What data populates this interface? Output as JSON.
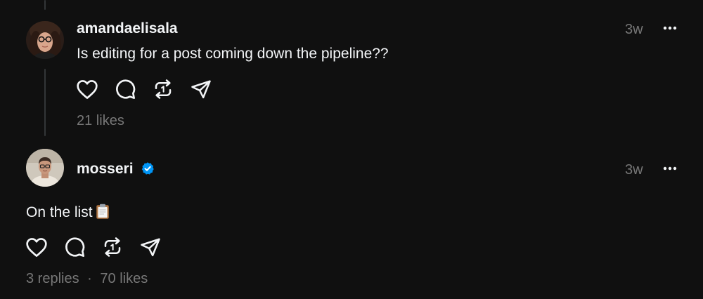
{
  "posts": [
    {
      "username": "amandaelisala",
      "time": "3w",
      "text": "Is editing for a post coming down the pipeline??",
      "likes": "21 likes"
    },
    {
      "username": "mosseri",
      "verified": true,
      "time": "3w",
      "text": "On the list",
      "emoji": "clipboard-emoji",
      "replies": "3 replies",
      "separator": "·",
      "likes": "70 likes"
    }
  ],
  "icons": [
    "heart-icon",
    "comment-icon",
    "repost-icon",
    "share-icon",
    "more-icon",
    "verified-badge-icon"
  ],
  "colors": {
    "background": "#101010",
    "text": "#f3f5f7",
    "secondary": "#777777",
    "thread_line": "#333638",
    "verified": "#0095f6"
  }
}
